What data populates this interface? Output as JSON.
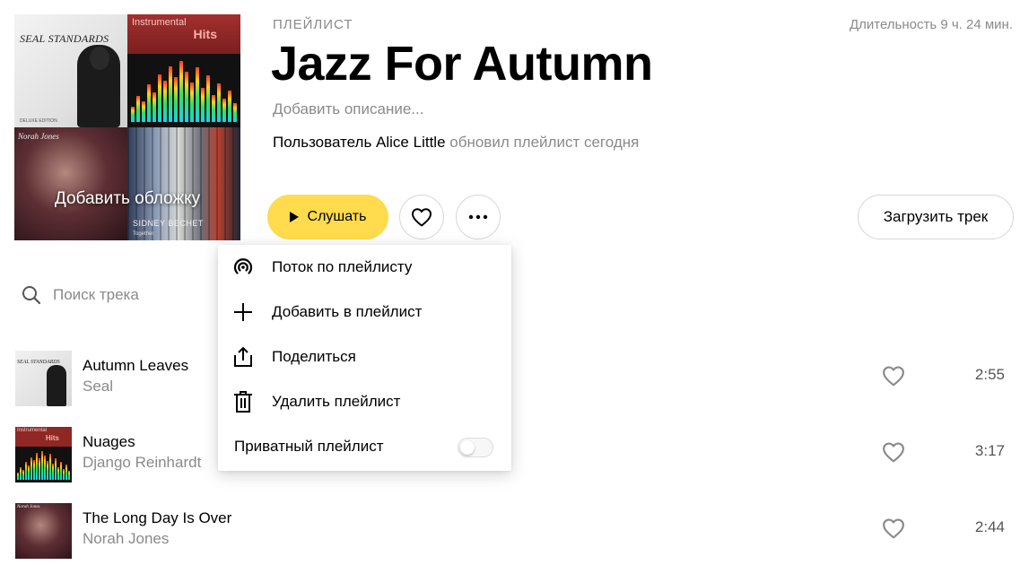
{
  "cover": {
    "add_cover_label": "Добавить обложку",
    "tiles": {
      "seal_title": "SEAL STANDARDS",
      "seal_small": "DELUXE EDITION",
      "hits_instrumental": "Instrumental",
      "hits_title": "Hits",
      "norah_name": "Norah Jones",
      "sidney_name": "SIDNEY BECHET",
      "sidney_sub": "Together"
    }
  },
  "header": {
    "label": "ПЛЕЙЛИСТ",
    "title": "Jazz For Autumn",
    "description_placeholder": "Добавить описание...",
    "updated_prefix": "Пользователь Alice Little",
    "updated_suffix": " обновил плейлист сегодня",
    "duration": "Длительность 9 ч. 24 мин."
  },
  "actions": {
    "listen_label": "Слушать",
    "upload_label": "Загрузить трек",
    "like_icon": "heart-icon",
    "more_icon": "more-dots-icon"
  },
  "search": {
    "placeholder": "Поиск трека",
    "value": ""
  },
  "menu": {
    "items": [
      {
        "label": "Поток по плейлисту",
        "icon": "radio-wave-icon"
      },
      {
        "label": "Добавить в плейлист",
        "icon": "plus-icon"
      },
      {
        "label": "Поделиться",
        "icon": "share-icon"
      },
      {
        "label": "Удалить плейлист",
        "icon": "trash-icon"
      }
    ],
    "private_label": "Приватный плейлист",
    "private_enabled": false
  },
  "tracks": [
    {
      "title": "Autumn Leaves",
      "artist": "Seal",
      "duration": "2:55",
      "cover_title": "SEAL STANDARDS"
    },
    {
      "title": "Nuages",
      "artist": "Django Reinhardt",
      "duration": "3:17",
      "cover_inst": "Instrumental",
      "cover_title": "Hits"
    },
    {
      "title": "The Long Day Is Over",
      "artist": "Norah Jones",
      "duration": "2:44",
      "cover_title": "Norah Jones"
    }
  ],
  "colors": {
    "accent_yellow": "#ffdb4d",
    "secondary_text": "#8a8a8a"
  }
}
